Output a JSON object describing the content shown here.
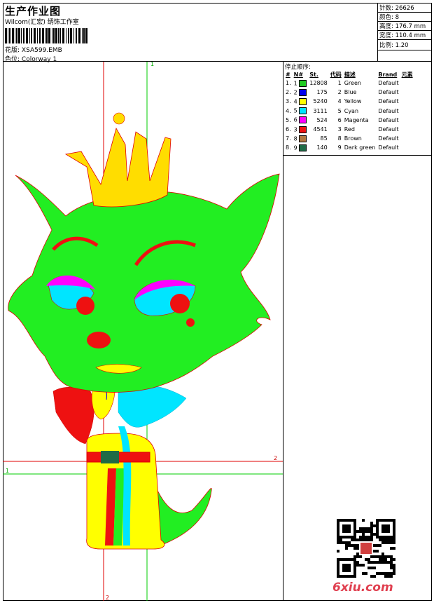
{
  "header": {
    "title": "生产作业图",
    "company": "Wilcom(汇宏) 绣饰工作室",
    "design_label": "花版:",
    "design_value": "XSA599.EMB",
    "colorway_label": "色位:",
    "colorway_value": "Colorway 1"
  },
  "stats": [
    {
      "label": "针数:",
      "value": "26626"
    },
    {
      "label": "颜色:",
      "value": "8"
    },
    {
      "label": "高度:",
      "value": "176.7 mm"
    },
    {
      "label": "宽度:",
      "value": "110.4 mm"
    },
    {
      "label": "比例:",
      "value": "1.20"
    }
  ],
  "canvas": {
    "marker_top": "1",
    "marker_bottom": "2",
    "marker_left": "1",
    "marker_right": "2"
  },
  "stop_sequence": {
    "title": "停止顺序:",
    "headers": [
      "#",
      "N#",
      "St.",
      "代码",
      "描述",
      "Brand",
      "元素"
    ],
    "rows": [
      {
        "idx": "1.",
        "n": "1",
        "color": "#22cc22",
        "st": "12808",
        "code": "1",
        "desc": "Green",
        "brand": "Default"
      },
      {
        "idx": "2.",
        "n": "2",
        "color": "#0000ee",
        "st": "175",
        "code": "2",
        "desc": "Blue",
        "brand": "Default"
      },
      {
        "idx": "3.",
        "n": "4",
        "color": "#ffff00",
        "st": "5240",
        "code": "4",
        "desc": "Yellow",
        "brand": "Default"
      },
      {
        "idx": "4.",
        "n": "5",
        "color": "#00e5ff",
        "st": "3111",
        "code": "5",
        "desc": "Cyan",
        "brand": "Default"
      },
      {
        "idx": "5.",
        "n": "6",
        "color": "#ff00ff",
        "st": "524",
        "code": "6",
        "desc": "Magenta",
        "brand": "Default"
      },
      {
        "idx": "6.",
        "n": "3",
        "color": "#ee1111",
        "st": "4541",
        "code": "3",
        "desc": "Red",
        "brand": "Default"
      },
      {
        "idx": "7.",
        "n": "8",
        "color": "#b07840",
        "st": "85",
        "code": "8",
        "desc": "Brown",
        "brand": "Default"
      },
      {
        "idx": "8.",
        "n": "9",
        "color": "#1f6b46",
        "st": "140",
        "code": "9",
        "desc": "Dark green",
        "brand": "Default"
      }
    ]
  },
  "watermark": {
    "site": "6xiu.com"
  }
}
